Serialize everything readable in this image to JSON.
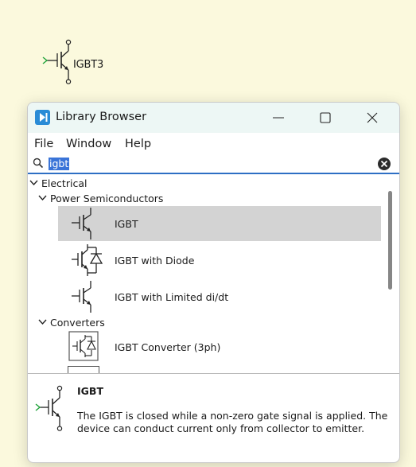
{
  "canvas": {
    "component_label": "IGBT3",
    "component_icon": "igbt-symbol-icon"
  },
  "window": {
    "title": "Library Browser",
    "app_icon": "library-browser-app-icon",
    "controls": {
      "minimize": "minimize-icon",
      "maximize": "maximize-icon",
      "close": "close-icon"
    }
  },
  "menu": {
    "file": "File",
    "window": "Window",
    "help": "Help"
  },
  "search": {
    "value": "igbt",
    "clear_icon": "clear-search-icon"
  },
  "tree": {
    "electrical": "Electrical",
    "power_semiconductors": "Power Semiconductors",
    "items": [
      {
        "label": "IGBT",
        "selected": true
      },
      {
        "label": "IGBT with Diode",
        "selected": false
      },
      {
        "label": "IGBT with Limited di/dt",
        "selected": false
      }
    ],
    "converters": "Converters",
    "converter_items": [
      {
        "label": "IGBT Converter (3ph)"
      }
    ]
  },
  "description": {
    "title": "IGBT",
    "text": "The IGBT is closed while a non-zero gate signal is applied. The device can conduct current only from collector to emitter."
  },
  "colors": {
    "canvas_bg": "#fbf9dd",
    "titlebar_bg": "#edf7f5",
    "accent": "#2a8bd6",
    "selection": "#d3d3d3",
    "gate_green": "#1fa33a"
  }
}
